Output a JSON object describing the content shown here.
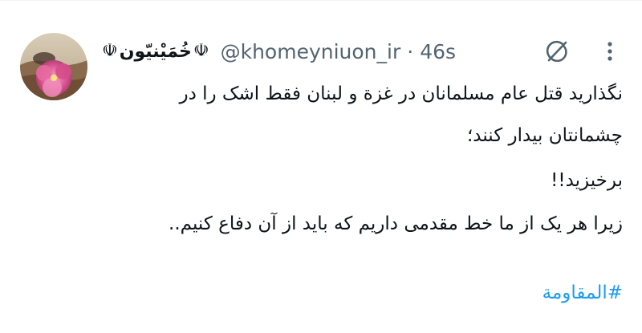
{
  "tweet": {
    "author": {
      "emblem_left": "☫",
      "display_name": "خُمَیْنیّون",
      "emblem_right": "☫",
      "handle": "@khomeyniuon_ir",
      "separator": "·",
      "time": "46s"
    },
    "body_lines": [
      "نگذارید قتل عام مسلمانان در غزة و لبنان فقط اشک را در",
      "چشمانتان بیدار کنند؛",
      "برخیزید!!",
      "زیرا هر یک از ما خط مقدمی داریم که باید از آن دفاع کنیم.."
    ],
    "hashtag": "#المقاومة"
  },
  "icons": {
    "grok": "grok-icon",
    "more": "more-vertical-icon",
    "avatar": "avatar-image"
  },
  "colors": {
    "text": "#0f1419",
    "secondary": "#536471",
    "link": "#1d9bf0",
    "background": "#ffffff"
  }
}
